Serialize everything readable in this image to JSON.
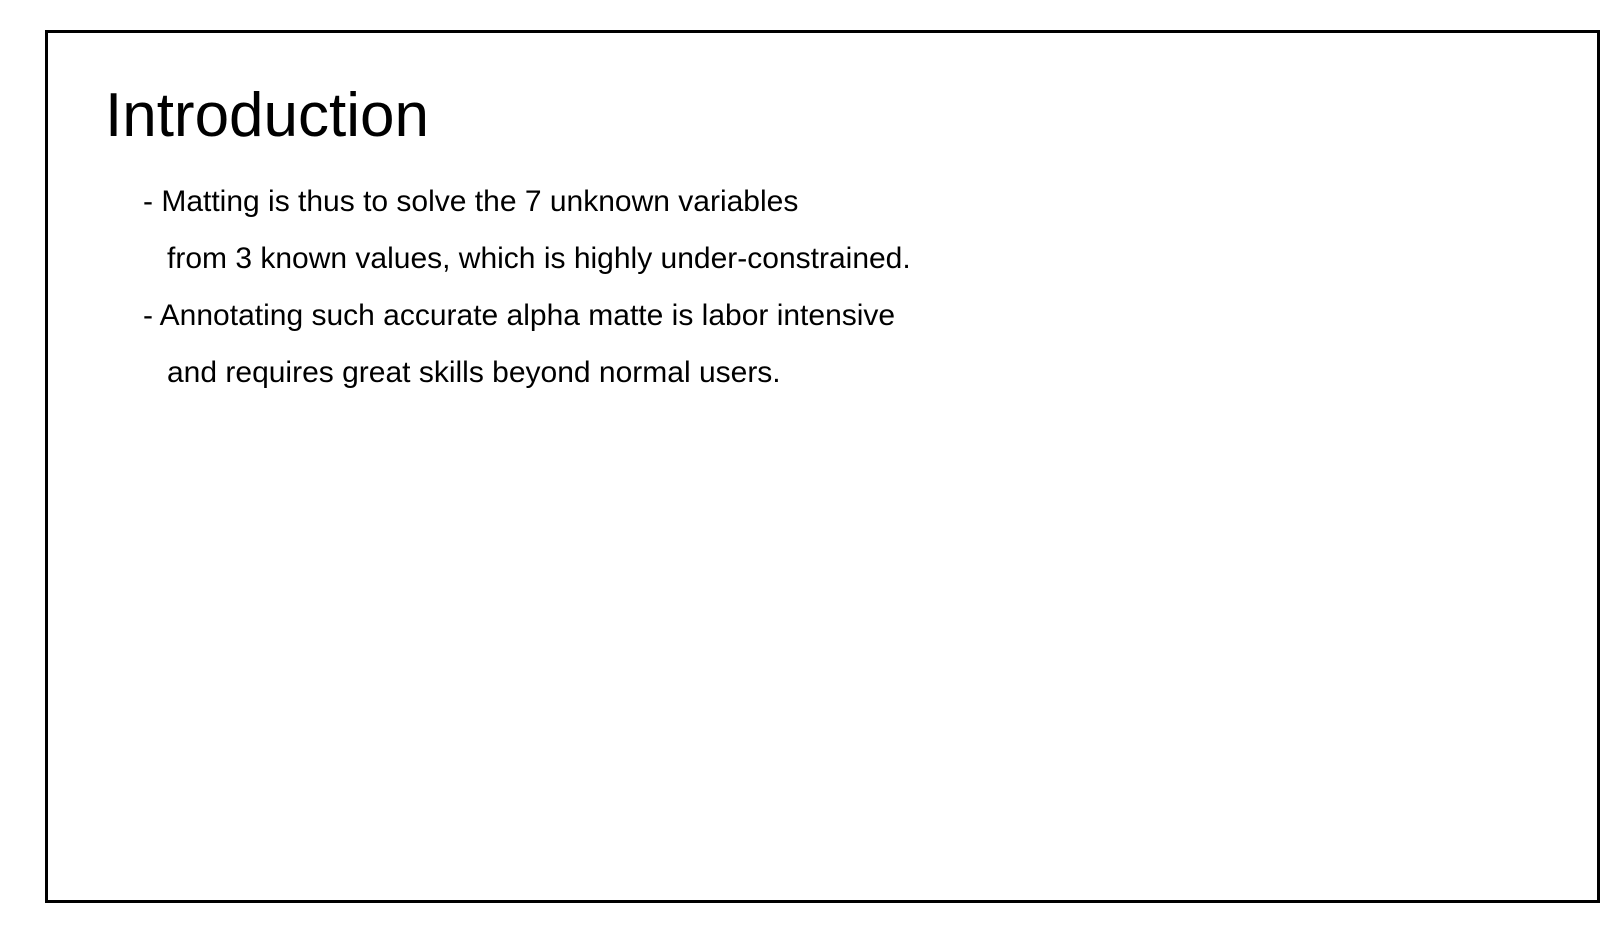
{
  "slide": {
    "title": "Introduction",
    "lines": [
      "- Matting is thus to solve the 7 unknown variables",
      "from 3 known values, which is highly under-constrained.",
      "- Annotating such accurate alpha matte is labor intensive",
      "and requires great skills beyond normal users."
    ]
  }
}
